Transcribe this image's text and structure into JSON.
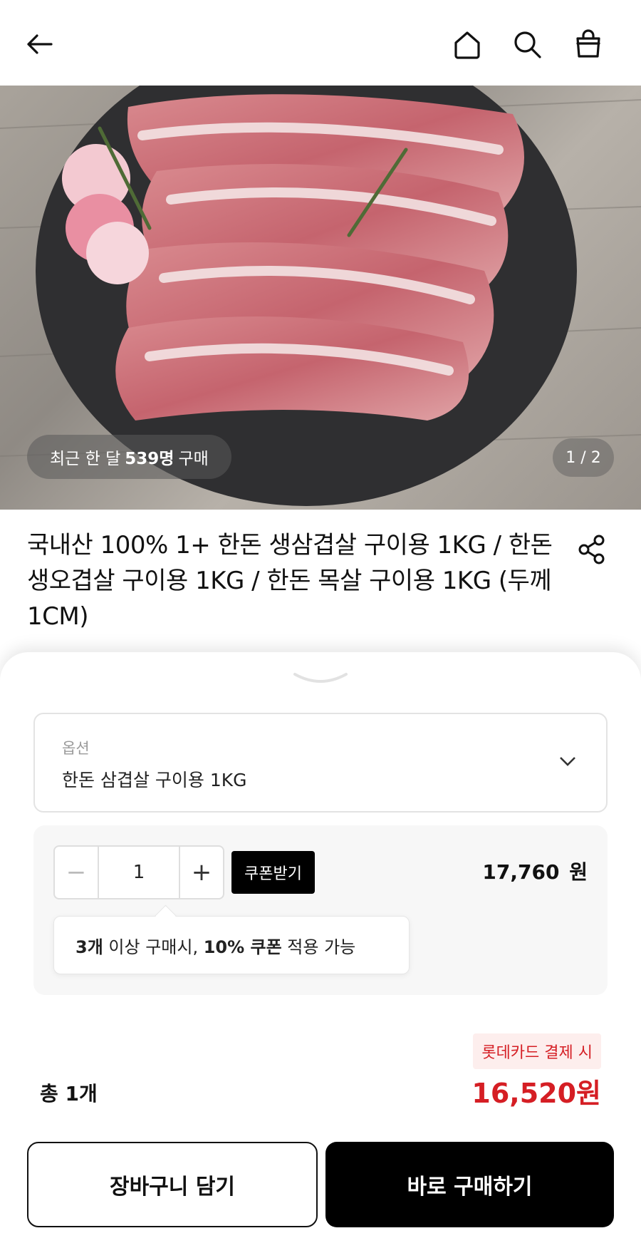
{
  "header": {
    "back_icon": "arrow-left-icon",
    "home_icon": "home-icon",
    "search_icon": "search-icon",
    "bag_icon": "shopping-bag-icon"
  },
  "hero": {
    "purchase_prefix": "최근 한 달",
    "purchase_count": "539명",
    "purchase_suffix": "구매",
    "pager": "1 / 2"
  },
  "product": {
    "title": "국내산 100% 1+ 한돈 생삼겹살 구이용 1KG / 한돈 생오겹살 구이용 1KG / 한돈 목살 구이용 1KG (두께 1CM)",
    "share_icon": "share-icon"
  },
  "sheet": {
    "option_label": "옵션",
    "option_value": "한돈 삼겹살 구이용 1KG",
    "quantity": "1",
    "coupon_button": "쿠폰받기",
    "price": "17,760",
    "price_unit": "원",
    "tip": {
      "qty": "3개",
      "mid": " 이상 구매시, ",
      "pct": "10% 쿠폰",
      "end": " 적용 가능"
    },
    "card_label": "롯데카드 결제 시",
    "total_label": "총 1개",
    "total_price": "16,520원",
    "cart_button": "장바구니 담기",
    "buy_button": "바로 구매하기"
  },
  "colors": {
    "accent": "#d51e24",
    "dark": "#000000"
  }
}
